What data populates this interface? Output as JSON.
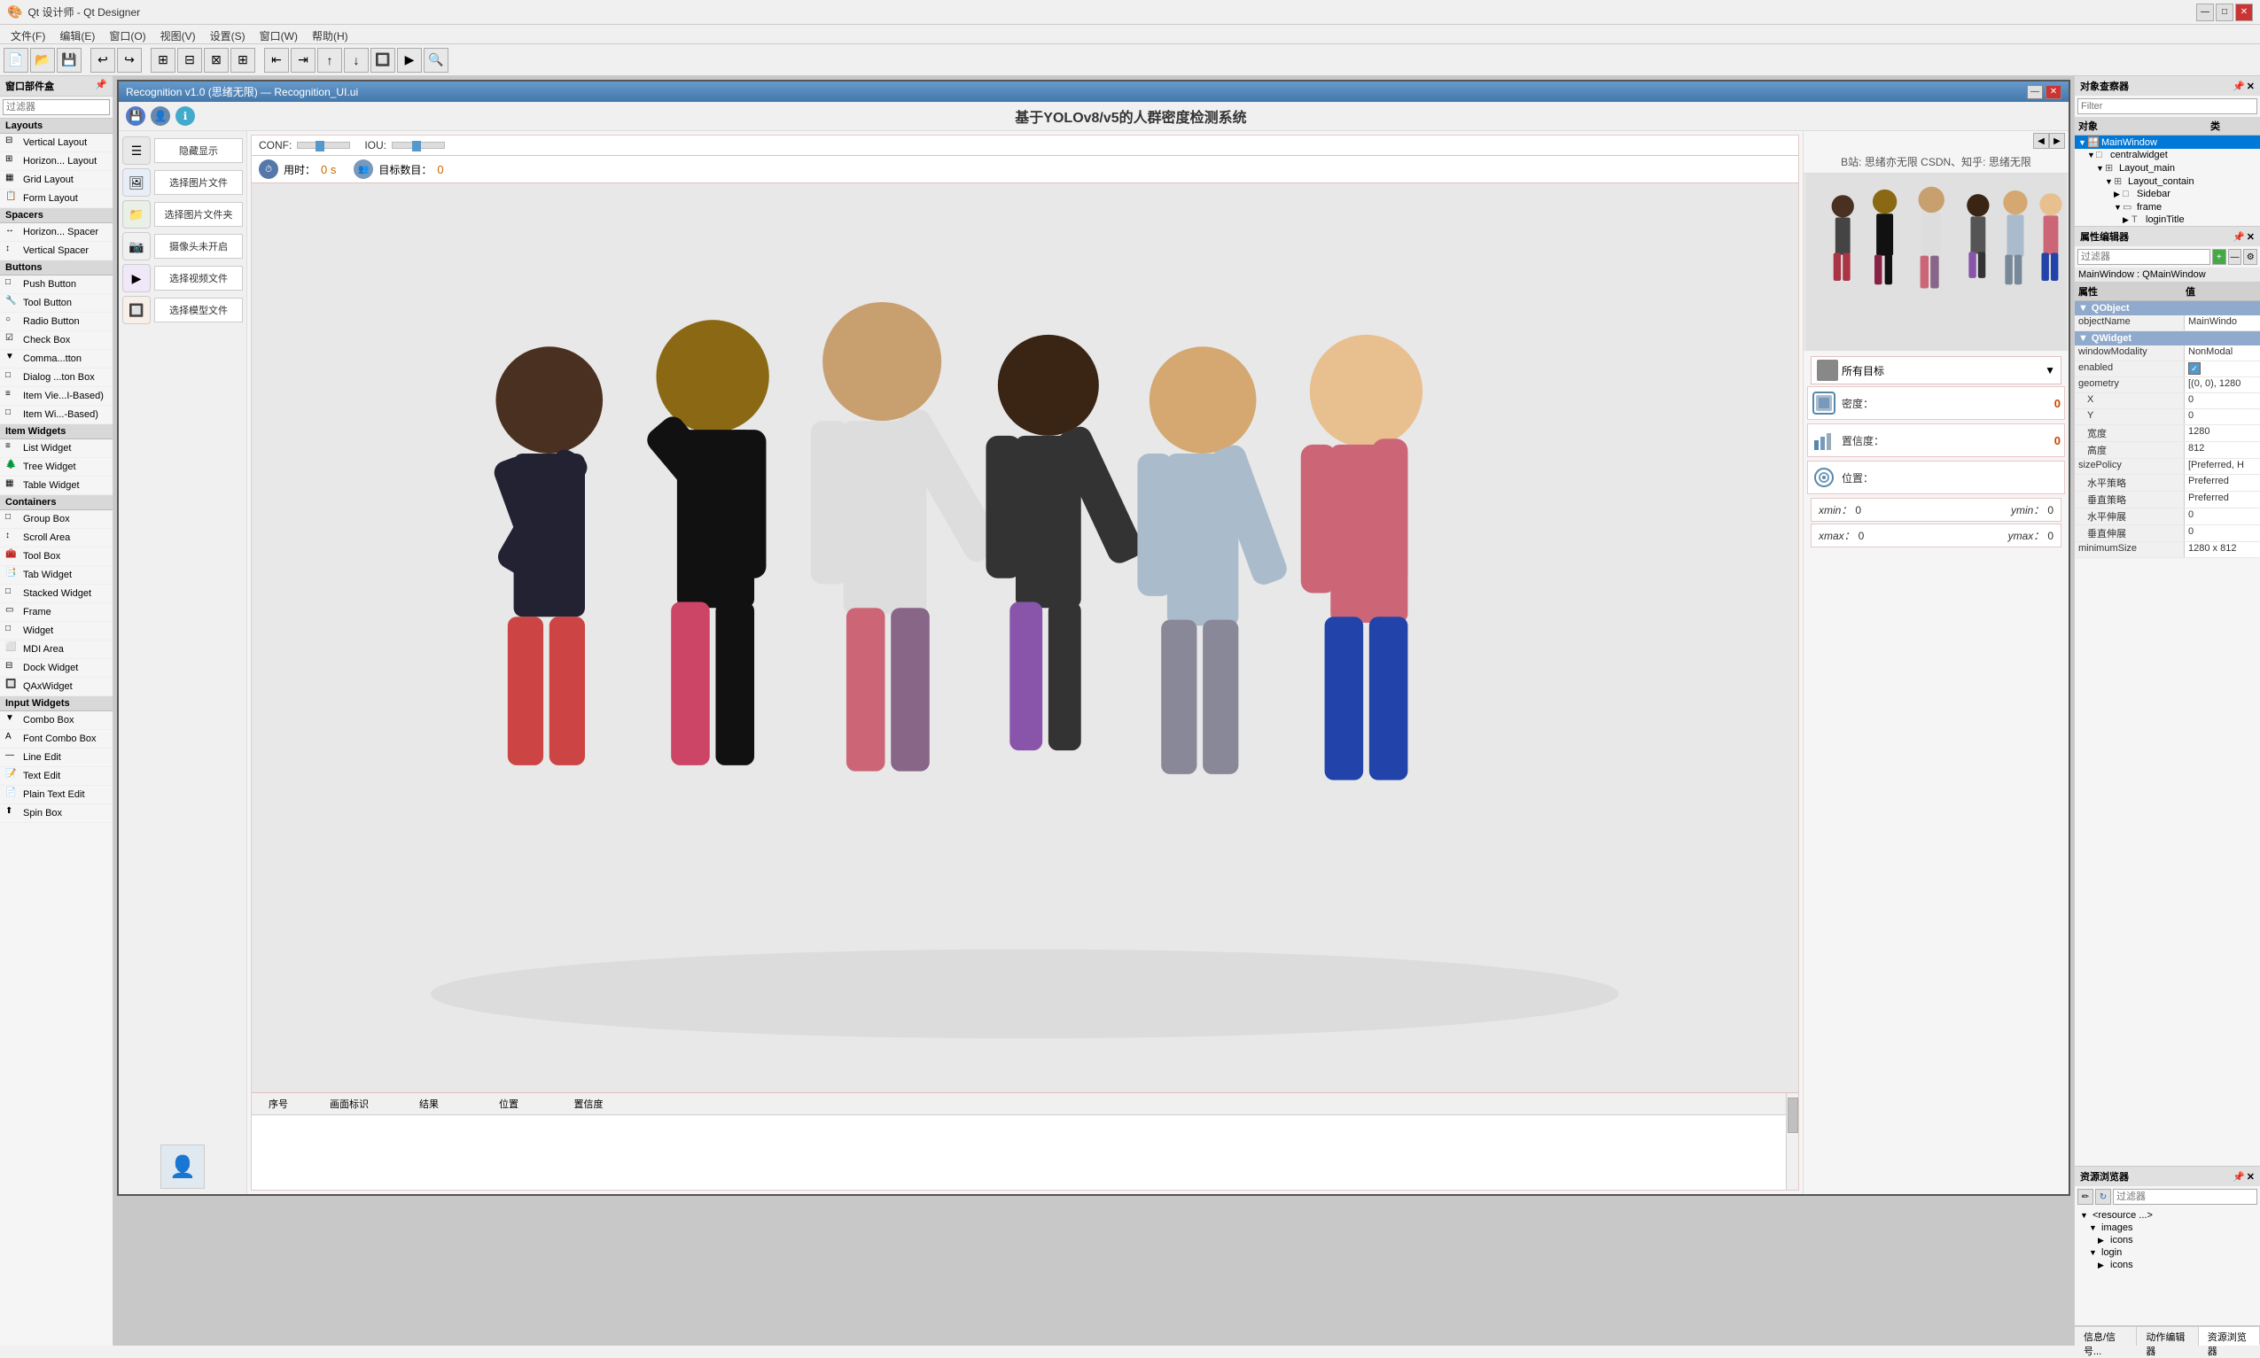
{
  "app": {
    "title": "Qt 设计师 - Qt Designer",
    "window_controls": [
      "—",
      "□",
      "✕"
    ]
  },
  "menu": {
    "items": [
      "文件(F)",
      "编辑(E)",
      "窗口(O)",
      "视图(V)",
      "设置(S)",
      "窗口(W)",
      "帮助(H)"
    ]
  },
  "widget_box": {
    "title": "窗口部件盒",
    "filter_placeholder": "过滤器",
    "categories": [
      {
        "name": "Layouts",
        "items": [
          {
            "label": "Vertical Layout",
            "icon": "⬜"
          },
          {
            "label": "Horizon... Layout",
            "icon": "⬜"
          },
          {
            "label": "Grid Layout",
            "icon": "⬜"
          },
          {
            "label": "Form Layout",
            "icon": "⬜"
          }
        ]
      },
      {
        "name": "Spacers",
        "items": [
          {
            "label": "Horizon... Spacer",
            "icon": "↔"
          },
          {
            "label": "Vertical Spacer",
            "icon": "↕"
          }
        ]
      },
      {
        "name": "Buttons",
        "items": [
          {
            "label": "Push Button",
            "icon": "□"
          },
          {
            "label": "Tool Button",
            "icon": "□"
          },
          {
            "label": "Radio Button",
            "icon": "○"
          },
          {
            "label": "Check Box",
            "icon": "☑"
          },
          {
            "label": "Comma...tton",
            "icon": "▼"
          },
          {
            "label": "Dialog ...ton Box",
            "icon": "□"
          },
          {
            "label": "Item Vie...I-Based)",
            "icon": "≡"
          },
          {
            "label": "Item Wi...-Based)",
            "icon": "□"
          }
        ]
      },
      {
        "name": "Item Widgets",
        "items": [
          {
            "label": "List Widget",
            "icon": "≡"
          },
          {
            "label": "Tree Widget",
            "icon": "🌲"
          },
          {
            "label": "Table Widget",
            "icon": "▦"
          }
        ]
      },
      {
        "name": "Containers",
        "items": [
          {
            "label": "Group Box",
            "icon": "□"
          },
          {
            "label": "Scroll Area",
            "icon": "□"
          },
          {
            "label": "Tool Box",
            "icon": "□"
          },
          {
            "label": "Tab Widget",
            "icon": "📑"
          },
          {
            "label": "Stacked Widget",
            "icon": "□"
          },
          {
            "label": "Frame",
            "icon": "□"
          },
          {
            "label": "Widget",
            "icon": "□"
          },
          {
            "label": "MDI Area",
            "icon": "□"
          },
          {
            "label": "Dock Widget",
            "icon": "□"
          },
          {
            "label": "QAxWidget",
            "icon": "□"
          }
        ]
      },
      {
        "name": "Input Widgets",
        "items": [
          {
            "label": "Combo Box",
            "icon": "▼"
          },
          {
            "label": "Font Combo Box",
            "icon": "A"
          },
          {
            "label": "Line Edit",
            "icon": "—"
          },
          {
            "label": "Text Edit",
            "icon": "📝"
          },
          {
            "label": "Plain Text Edit",
            "icon": "📝"
          },
          {
            "label": "Spin Box",
            "icon": "⬆"
          }
        ]
      }
    ]
  },
  "designer_window": {
    "title": "Recognition v1.0 (思绪无限)  —  Recognition_UI.ui",
    "app_title": "基于YOLOv8/v5的人群密度检测系统",
    "info_text": "B站: 思绪亦无限 CSDN、知乎: 思绪无限",
    "toolbar_icons": [
      "💾",
      "👤",
      "ℹ️"
    ],
    "sidebar_buttons": [
      {
        "label": "隐藏显示",
        "icon": "☰"
      },
      {
        "label": "选择图片文件",
        "icon": "🖼"
      },
      {
        "label": "选择图片文件夹",
        "icon": "📁"
      },
      {
        "label": "摄像头未开启",
        "icon": "📷"
      },
      {
        "label": "选择视频文件",
        "icon": "▶"
      },
      {
        "label": "选择模型文件",
        "icon": "🔲"
      }
    ],
    "conf_label": "CONF:",
    "iou_label": "IOU:",
    "time_label": "用时：",
    "time_value": "0 s",
    "target_label": "目标数目：",
    "target_value": "0",
    "table_columns": [
      "序号",
      "画面标识",
      "结果",
      "位置",
      "置信度"
    ],
    "dropdown_label": "所有目标",
    "density_label": "密度：",
    "density_value": "0",
    "confidence_label": "置信度：",
    "confidence_value": "0",
    "position_label": "位置：",
    "xmin_label": "xmin：",
    "xmin_value": "0",
    "ymin_label": "ymin：",
    "ymin_value": "0",
    "xmax_label": "xmax：",
    "xmax_value": "0",
    "ymax_label": "ymax：",
    "ymax_value": "0",
    "avatar_placeholder": "👤"
  },
  "object_inspector": {
    "title": "对象查察器",
    "filter_placeholder": "Filter",
    "col1": "对象",
    "col2": "类",
    "tree": [
      {
        "name": "MainWindow",
        "type": "",
        "level": 0,
        "expanded": true
      },
      {
        "name": "centralwidget",
        "type": "",
        "level": 1,
        "expanded": true
      },
      {
        "name": "Layout_main",
        "type": "",
        "level": 2,
        "expanded": true
      },
      {
        "name": "Layout_contain",
        "type": "",
        "level": 3,
        "expanded": true
      },
      {
        "name": "Sidebar",
        "type": "",
        "level": 4,
        "expanded": false
      },
      {
        "name": "frame",
        "type": "",
        "level": 4,
        "expanded": true
      },
      {
        "name": "loginTitle",
        "type": "",
        "level": 5,
        "expanded": false
      }
    ]
  },
  "property_editor": {
    "title": "属性编辑器",
    "filter_placeholder": "过滤器",
    "context": "MainWindow : QMainWindow",
    "groups": [
      {
        "name": "QObject",
        "properties": [
          {
            "name": "objectName",
            "value": "MainWindo",
            "highlight": false
          }
        ]
      },
      {
        "name": "QWidget",
        "properties": [
          {
            "name": "windowModality",
            "value": "NonModal",
            "highlight": false
          },
          {
            "name": "enabled",
            "value": "☑",
            "highlight": false
          },
          {
            "name": "geometry",
            "value": "[(0, 0), 1280",
            "highlight": false
          },
          {
            "name": "X",
            "value": "0",
            "highlight": false
          },
          {
            "name": "Y",
            "value": "0",
            "highlight": false
          },
          {
            "name": "宽度",
            "value": "1280",
            "highlight": false
          },
          {
            "name": "高度",
            "value": "812",
            "highlight": false
          },
          {
            "name": "sizePolicy",
            "value": "[Preferred, H",
            "highlight": false
          },
          {
            "name": "水平策略",
            "value": "Preferred",
            "highlight": false
          },
          {
            "name": "垂直策略",
            "value": "Preferred",
            "highlight": false
          },
          {
            "name": "水平伸展",
            "value": "0",
            "highlight": false
          },
          {
            "name": "垂直伸展",
            "value": "0",
            "highlight": false
          },
          {
            "name": "minimumSize",
            "value": "1280 x 812",
            "highlight": false
          }
        ]
      }
    ]
  },
  "resource_browser": {
    "title": "资源浏览器",
    "filter_placeholder": "过滤器",
    "tree": [
      {
        "name": "<resource ...>",
        "level": 0,
        "expanded": true
      },
      {
        "name": "images",
        "level": 1,
        "expanded": true
      },
      {
        "name": "icons",
        "level": 2,
        "expanded": false
      },
      {
        "name": "login",
        "level": 1,
        "expanded": true
      },
      {
        "name": "icons",
        "level": 2,
        "expanded": false
      }
    ]
  },
  "bottom_tabs": [
    "信息/信号...",
    "动作编辑器",
    "资源浏览器"
  ]
}
